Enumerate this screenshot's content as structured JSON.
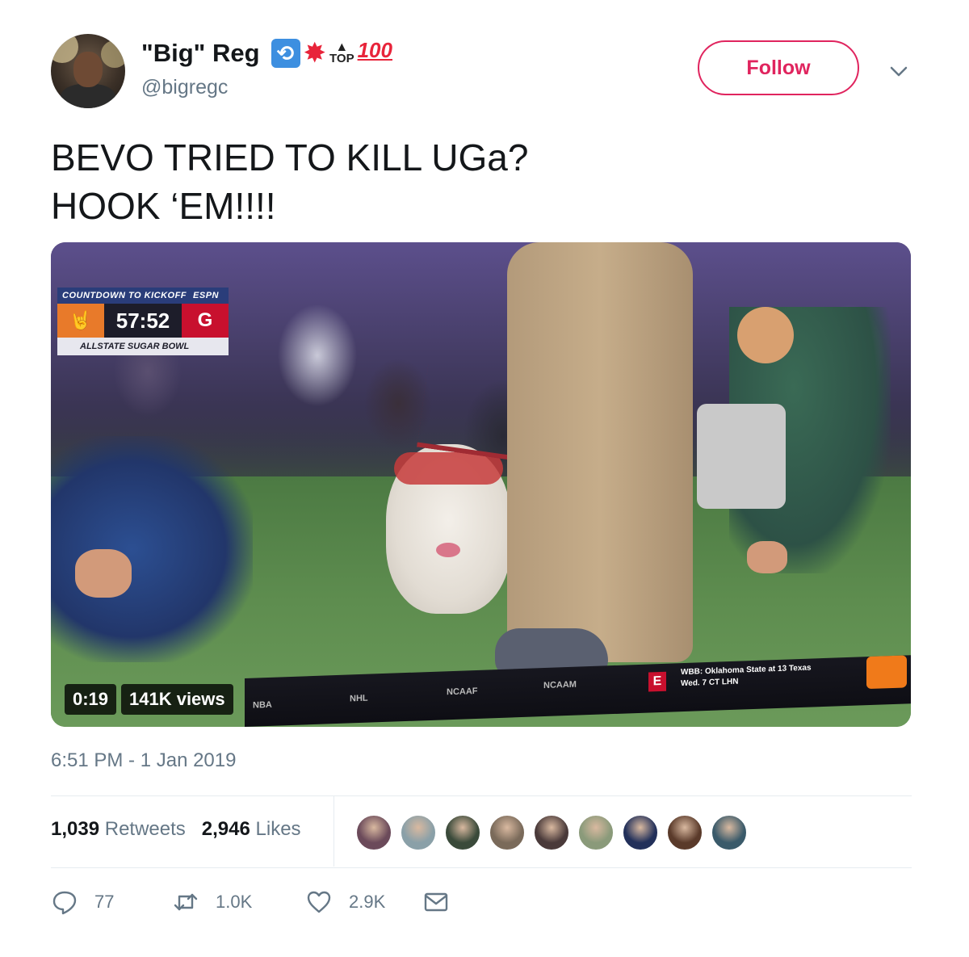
{
  "user": {
    "display_name": "\"Big\" Reg",
    "handle": "@bigregc",
    "emoji": {
      "retweet": "🔁",
      "boom": "💥",
      "top": "TOP",
      "top_arrow": "🔝",
      "hundred": "100"
    }
  },
  "header": {
    "follow_label": "Follow"
  },
  "tweet": {
    "line1": "BEVO TRIED TO KILL UGa?",
    "line2": "HOOK ‘EM!!!!"
  },
  "video": {
    "duration": "0:19",
    "views": "141K views",
    "scorebug": {
      "header": "COUNTDOWN TO KICKOFF",
      "network": "ESPN",
      "clock": "57:52",
      "team_left": "🤘",
      "team_right": "G",
      "footer": "ALLSTATE SUGAR BOWL"
    },
    "ticker": {
      "items": [
        "NBA",
        "NHL",
        "NCAAF",
        "NCAAM"
      ],
      "line1": "WBB: Oklahoma State at 13 Texas",
      "line2": "Wed. 7 CT LHN",
      "logo": "E"
    }
  },
  "timestamp": "6:51 PM - 1 Jan 2019",
  "stats": {
    "retweets_count": "1,039",
    "retweets_label": "Retweets",
    "likes_count": "2,946",
    "likes_label": "Likes"
  },
  "likers": [
    {
      "color": "#6b4a5a"
    },
    {
      "color": "#8aa0a8"
    },
    {
      "color": "#3a4a3a"
    },
    {
      "color": "#7a6a5a"
    },
    {
      "color": "#4a3a3a"
    },
    {
      "color": "#8a9a7a"
    },
    {
      "color": "#22305a"
    },
    {
      "color": "#5a3a2a"
    },
    {
      "color": "#3a5a6a"
    }
  ],
  "actions": {
    "reply_count": "77",
    "retweet_count": "1.0K",
    "like_count": "2.9K"
  },
  "colors": {
    "follow_accent": "#e0245e",
    "secondary_text": "#657786",
    "divider": "#e6ecf0"
  }
}
